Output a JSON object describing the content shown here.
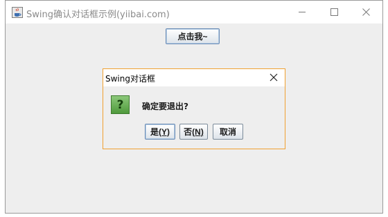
{
  "window": {
    "title": "Swing确认对话框示例(yiibai.com)",
    "icon": "java-cup-icon",
    "controls": [
      "minimize-icon",
      "maximize-icon",
      "close-icon"
    ]
  },
  "main": {
    "click_button_label": "点击我~"
  },
  "dialog": {
    "title": "Swing对话框",
    "icon": "question-icon",
    "icon_glyph": "?",
    "message": "确定要退出?",
    "buttons": {
      "yes_label": "是",
      "yes_mnemonic": "(Y)",
      "no_label": "否",
      "no_mnemonic": "(N)",
      "cancel_label": "取消"
    }
  },
  "colors": {
    "dialog_border": "#f0a030",
    "question_icon": "#5fa84a",
    "background": "#eeeeee"
  }
}
